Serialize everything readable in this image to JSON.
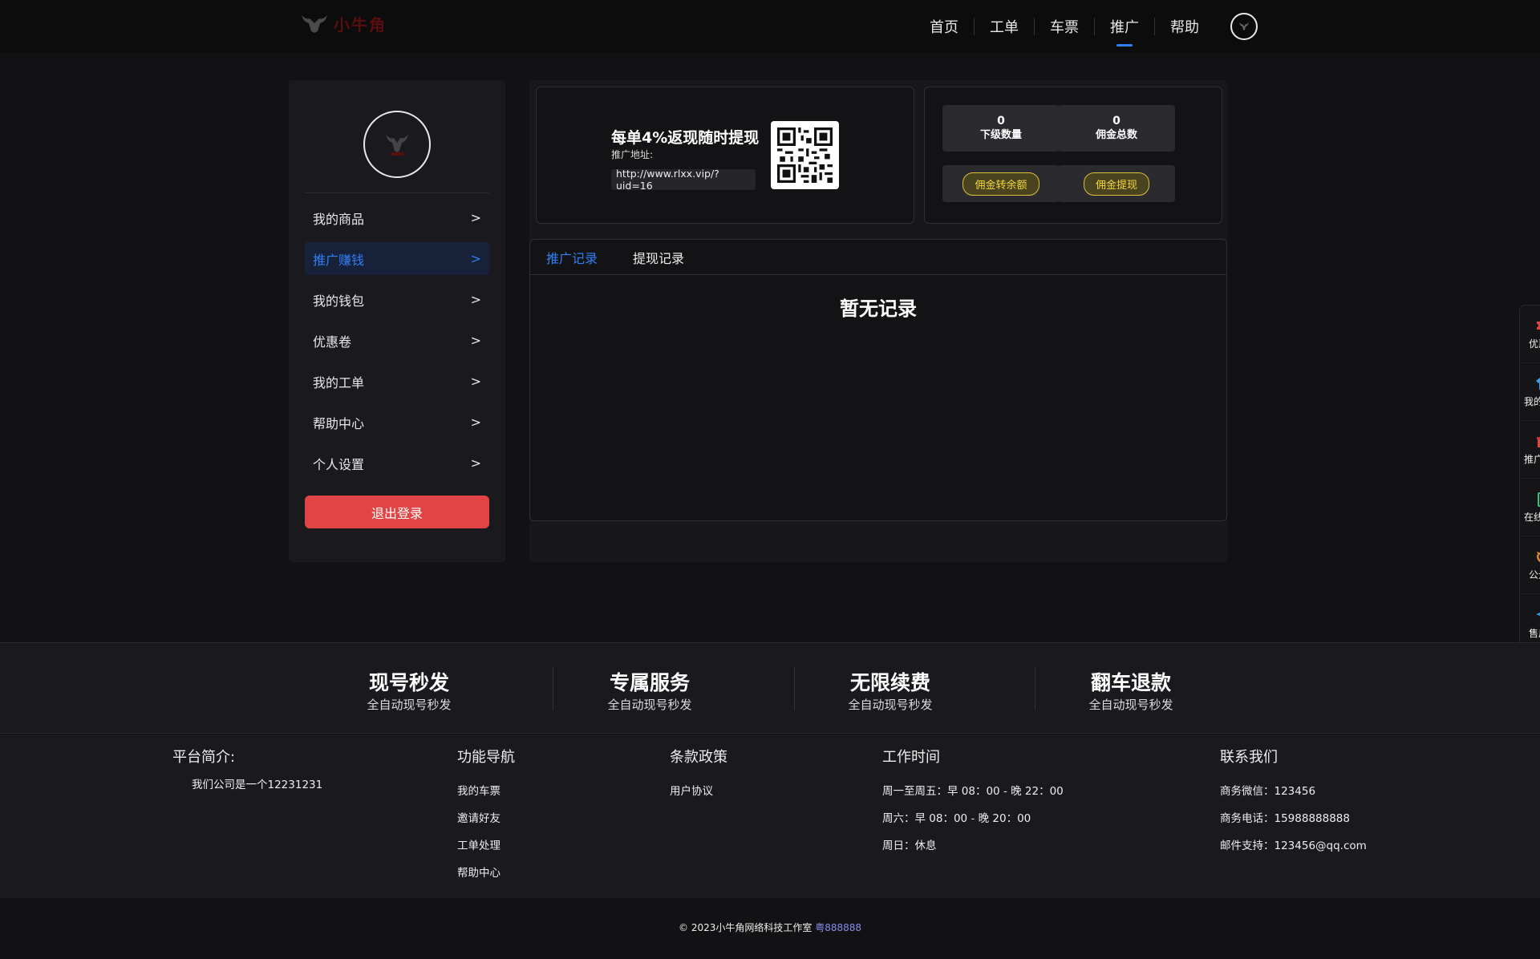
{
  "header": {
    "logo_text": "小牛角",
    "nav": [
      {
        "label": "首页",
        "active": false
      },
      {
        "label": "工单",
        "active": false
      },
      {
        "label": "车票",
        "active": false
      },
      {
        "label": "推广",
        "active": true
      },
      {
        "label": "帮助",
        "active": false
      }
    ],
    "accent": "#2e7ff2"
  },
  "sidebar": {
    "menu": [
      {
        "label": "我的商品",
        "arrow": ">"
      },
      {
        "label": "推广赚钱",
        "arrow": ">"
      },
      {
        "label": "我的钱包",
        "arrow": ">"
      },
      {
        "label": "优惠卷",
        "arrow": ">"
      },
      {
        "label": "我的工单",
        "arrow": ">"
      },
      {
        "label": "帮助中心",
        "arrow": ">"
      },
      {
        "label": "个人设置",
        "arrow": ">"
      }
    ],
    "logout_label": "退出登录",
    "logout_color": "#e04444"
  },
  "promo": {
    "title": "每单4%返现随时提现",
    "address_label": "推广地址:",
    "url": "http://www.rlxx.vip/?uid=16"
  },
  "stats": {
    "sub_count_value": "0",
    "sub_count_label": "下级数量",
    "commission_total_value": "0",
    "commission_total_label": "佣金总数",
    "transfer_button": "佣金转余额",
    "withdraw_button": "佣金提现"
  },
  "records": {
    "tabs": [
      "推广记录",
      "提现记录"
    ],
    "empty_text": "暂无记录"
  },
  "floatbar": {
    "items": [
      {
        "label": "优惠卷",
        "icon": "ticket-icon",
        "color": "#e04444"
      },
      {
        "label": "我的商品",
        "icon": "shirt-icon",
        "color": "#3a9be8"
      },
      {
        "label": "推广返现",
        "icon": "gift-icon",
        "color": "#e04444"
      },
      {
        "label": "在线工单",
        "icon": "clipboard-icon",
        "color": "#2ec27e"
      },
      {
        "label": "公众号",
        "icon": "refresh-icon",
        "color": "#e08a2e"
      },
      {
        "label": "售后群",
        "icon": "telegram-icon",
        "color": "#2e9be8"
      }
    ]
  },
  "features": [
    {
      "title": "现号秒发",
      "sub": "全自动现号秒发"
    },
    {
      "title": "专属服务",
      "sub": "全自动现号秒发"
    },
    {
      "title": "无限续费",
      "sub": "全自动现号秒发"
    },
    {
      "title": "翻车退款",
      "sub": "全自动现号秒发"
    }
  ],
  "footer": {
    "intro_title": "平台简介:",
    "intro_text": "我们公司是一个12231231",
    "nav_title": "功能导航",
    "nav_links": [
      "我的车票",
      "邀请好友",
      "工单处理",
      "帮助中心"
    ],
    "policy_title": "条款政策",
    "policy_links": [
      "用户协议"
    ],
    "hours_title": "工作时间",
    "hours": [
      "周一至周五：早 08：00 - 晚 22：00",
      "周六：早 08：00 - 晚 20：00",
      "周日：休息"
    ],
    "contact_title": "联系我们",
    "contact": [
      "商务微信：123456",
      "商务电话：15988888888",
      "邮件支持：123456@qq.com"
    ]
  },
  "copyright": {
    "text": "© 2023小牛角网络科技工作室",
    "license": "粤888888"
  }
}
